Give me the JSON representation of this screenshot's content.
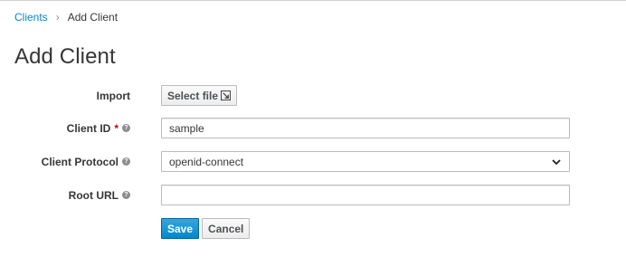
{
  "breadcrumb": {
    "parent": "Clients",
    "separator": "›",
    "current": "Add Client"
  },
  "page": {
    "title": "Add Client"
  },
  "form": {
    "import": {
      "label": "Import",
      "button_label": "Select file"
    },
    "client_id": {
      "label": "Client ID",
      "required_mark": "*",
      "value": "sample"
    },
    "client_protocol": {
      "label": "Client Protocol",
      "selected": "openid-connect"
    },
    "root_url": {
      "label": "Root URL",
      "value": ""
    }
  },
  "actions": {
    "save_label": "Save",
    "cancel_label": "Cancel"
  },
  "icons": {
    "help": "help-circle-icon",
    "file": "file-select-icon",
    "chevron": "chevron-down-icon"
  },
  "colors": {
    "link": "#0088ce",
    "primary": "#0088ce",
    "required": "#cc0000"
  }
}
